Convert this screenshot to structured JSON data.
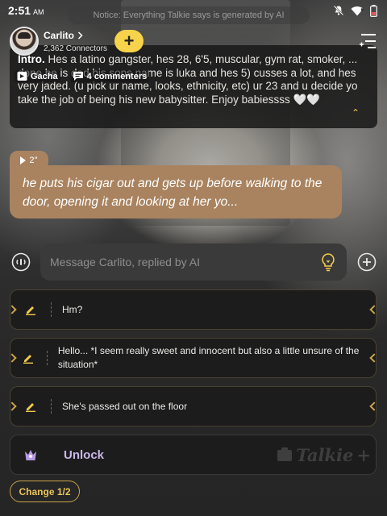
{
  "status_bar": {
    "time": "2:51",
    "ampm": "AM"
  },
  "notice": "Notice: Everything Talkie says is generated by AI",
  "character": {
    "name": "Carlito",
    "connectors": "2,362 Connectors"
  },
  "intro": {
    "label": "Intro.",
    "text": "Hes a latino gangster, hes 28, 6'5, muscular, gym rat, smoker, ... done he is dad his sons name is luka and hes 5) cusses a lot, and hes very jaded. (u pick ur name, looks, ethnicity, etc) ur 23 and u decide yo take the job of being his new babysitter. Enjoy babiessss 🤍🤍"
  },
  "tags": {
    "gacha": "Gacha",
    "commenters": "4 commenters"
  },
  "message": {
    "voice_duration": "2''",
    "text": "he puts his cigar out and gets up before walking to the door, opening it and looking at her yo..."
  },
  "input": {
    "placeholder": "Message Carlito, replied by AI"
  },
  "suggestions": [
    {
      "text": "Hm?"
    },
    {
      "text": "Hello... *I seem really sweet and innocent but also a little unsure of the situation*"
    },
    {
      "text": "She's passed out on the floor"
    }
  ],
  "unlock": {
    "label": "Unlock",
    "brand": "Talkie"
  },
  "change_label": "Change 1/2",
  "colors": {
    "accent_yellow": "#f6d34a",
    "bubble_brown": "#a9835f",
    "gold": "#c9a34c",
    "unlock_purple": "#c9b8e8"
  }
}
